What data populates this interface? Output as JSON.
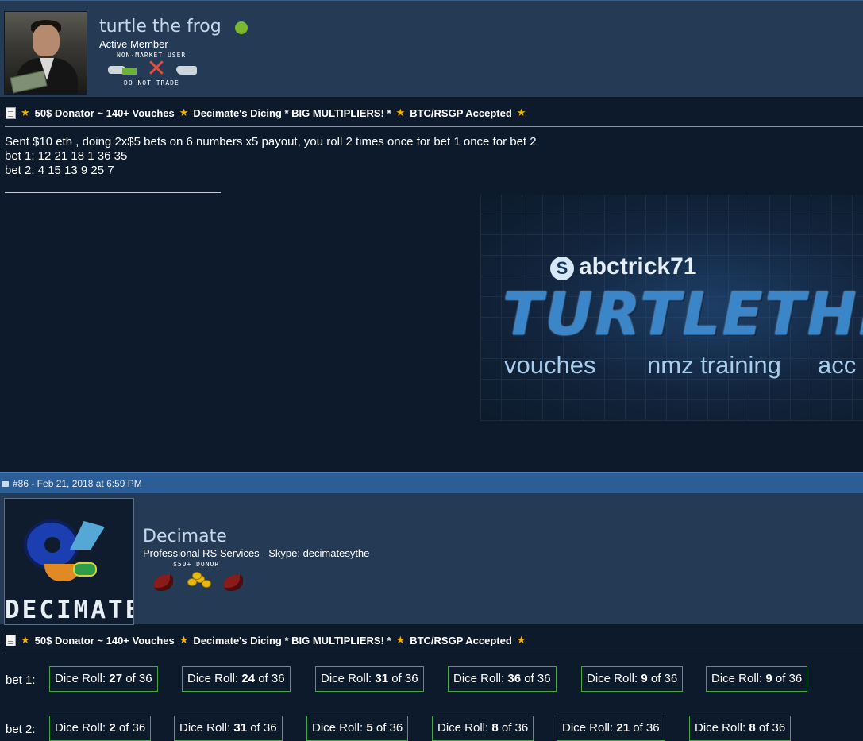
{
  "post1": {
    "username": "turtle the frog",
    "user_title": "Active Member",
    "badge_top": "NON-MARKET USER",
    "badge_bottom": "DO NOT TRADE",
    "signature": {
      "left": "50$ Donator ~ 140+ Vouches",
      "middle": "Decimate's Dicing * BIG MULTIPLIERS! *",
      "right": "BTC/RSGP Accepted"
    },
    "body_lines": [
      "Sent $10 eth , doing 2x$5 bets on 6 numbers x5 payout, you roll 2 times once for bet 1 once for bet 2",
      "bet 1: 12 21 18 1 36 35",
      "bet 2: 4 15 13 9 25 7"
    ],
    "banner": {
      "skype": "abctrick71",
      "title": "TURTLETHEF",
      "words": [
        "vouches",
        "nmz training",
        "acc"
      ]
    }
  },
  "post2_header": {
    "meta": "#86 - Feb 21, 2018 at 6:59 PM"
  },
  "post2": {
    "username": "Decimate",
    "user_title": "Professional RS Services - Skype: decimatesythe",
    "badge_top": "$50+ DONOR",
    "avatar_text": "DECIMATE",
    "signature": {
      "left": "50$ Donator ~ 140+ Vouches",
      "middle": "Decimate's Dicing * BIG MULTIPLIERS! *",
      "right": "BTC/RSGP Accepted"
    },
    "dice_prefix": "Dice Roll:",
    "dice_of": "of 36",
    "bets": [
      {
        "label": "bet 1:",
        "rolls": [
          "27",
          "24",
          "31",
          "36",
          "9",
          "9"
        ]
      },
      {
        "label": "bet 2:",
        "rolls": [
          "2",
          "31",
          "5",
          "8",
          "21",
          "8"
        ]
      }
    ]
  },
  "colors": {
    "userbar": "#243a55",
    "post_header": "#2b5d96",
    "background": "#0c1a2b",
    "online": "#7ab82f",
    "star": "#f2b300",
    "dice_border": "#45a845"
  }
}
